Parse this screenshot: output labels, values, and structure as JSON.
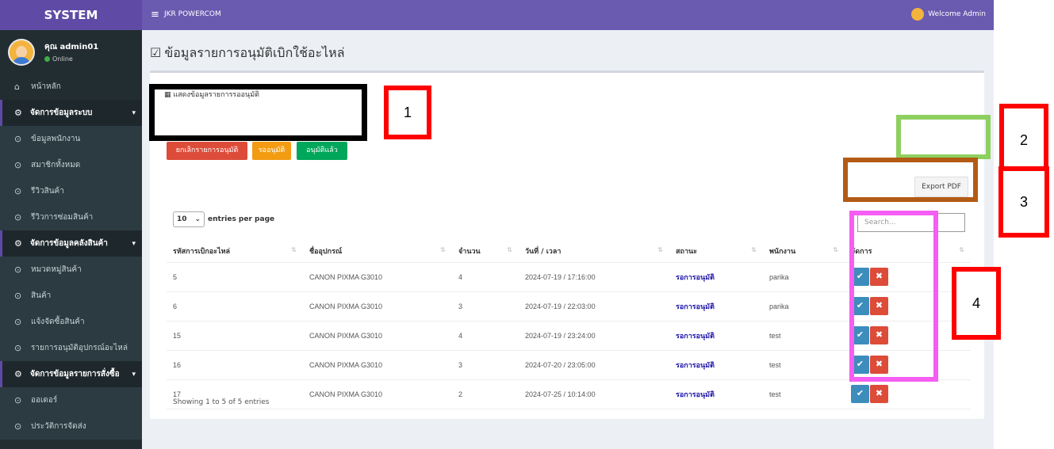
{
  "sidebar": {
    "logo": "SYSTEM",
    "user": {
      "name": "คุณ admin01",
      "status": "Online"
    },
    "home": "หน้าหลัก",
    "sections": [
      {
        "title": "จัดการข้อมูลระบบ",
        "items": [
          "ข้อมูลพนักงาน",
          "สมาชิกทั้งหมด",
          "รีวิวสินค้า",
          "รีวิวการซ่อมสินค้า"
        ]
      },
      {
        "title": "จัดการข้อมูลคลังสินค้า",
        "items": [
          "หมวดหมู่สินค้า",
          "สินค้า",
          "แจ้งจัดซื้อสินค้า",
          "รายการอนุมัติอุปกรณ์อะไหล่"
        ]
      },
      {
        "title": "จัดการข้อมูลรายการสั่งซื้อ",
        "items": [
          "ออเดอร์",
          "ประวัติการจัดส่ง"
        ]
      }
    ]
  },
  "topbar": {
    "menu_icon": "hamburger-icon",
    "brand": "JKR POWERCOM",
    "welcome": "Welcome Admin"
  },
  "page": {
    "title": "ข้อมูลรายการอนุมัติเบิกใช้อะไหล่",
    "box_title": "แสดงข้อมูลรายการรออนุมัติ",
    "buttons": {
      "cancel": "ยกเลิกรายการอนุมัติ",
      "waiting": "รออนุมัติ",
      "approved": "อนุมัติแล้ว",
      "export": "Export PDF"
    },
    "entries": {
      "value": "10",
      "label": "entries per page"
    },
    "search_placeholder": "Search...",
    "table": {
      "headers": [
        "รหัสการเบิกอะไหล่",
        "ชื่ออุปกรณ์",
        "จำนวน",
        "วันที่ / เวลา",
        "สถานะ",
        "พนักงาน",
        "จัดการ"
      ],
      "rows": [
        [
          "5",
          "CANON PIXMA G3010",
          "4",
          "2024-07-19 / 17:16:00",
          "รอการอนุมัติ",
          "parika"
        ],
        [
          "6",
          "CANON PIXMA G3010",
          "3",
          "2024-07-19 / 22:03:00",
          "รอการอนุมัติ",
          "parika"
        ],
        [
          "15",
          "CANON PIXMA G3010",
          "4",
          "2024-07-19 / 23:24:00",
          "รอการอนุมัติ",
          "test"
        ],
        [
          "16",
          "CANON PIXMA G3010",
          "3",
          "2024-07-20 / 23:05:00",
          "รอการอนุมัติ",
          "test"
        ],
        [
          "17",
          "CANON PIXMA G3010",
          "2",
          "2024-07-25 / 10:14:00",
          "รอการอนุมัติ",
          "test"
        ]
      ]
    },
    "showing": "Showing 1 to 5 of 5 entries"
  },
  "annotations": [
    "1",
    "2",
    "3",
    "4"
  ],
  "colors": {
    "sidebar": "#222d32",
    "topbar": "#6a5ab0",
    "logo": "#5f4ba5",
    "danger": "#dd4b39",
    "warning": "#f39c12",
    "success": "#00a65a",
    "primary": "#3c8dbc"
  }
}
